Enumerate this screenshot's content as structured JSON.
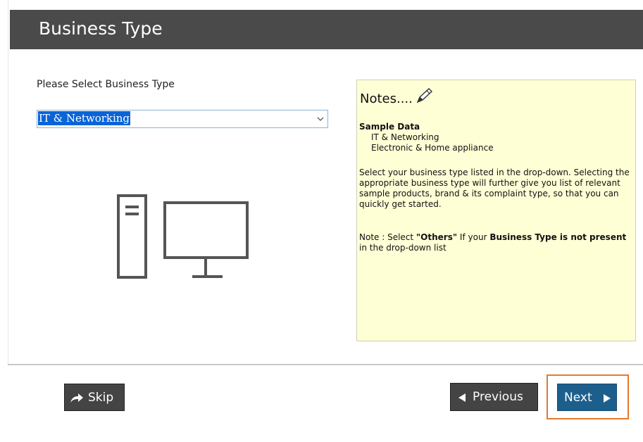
{
  "header": {
    "title": "Business Type"
  },
  "form": {
    "label": "Please Select Business Type",
    "selected_value": "IT & Networking"
  },
  "notes": {
    "title": "Notes....",
    "sample_heading": "Sample Data",
    "sample_items": [
      "IT & Networking",
      "Electronic & Home appliance"
    ],
    "paragraph_1": "Select your business type listed in the drop-down. Selecting the appropriate business type will further give you list of relevant sample products, brand & its complaint type, so that you can quickly get started.",
    "paragraph_2_parts": [
      "Note : Select ",
      "\"Others\"",
      " If your ",
      "Business Type is not present",
      " in the drop-down list"
    ]
  },
  "footer": {
    "skip_label": "Skip",
    "previous_label": "Previous",
    "next_label": "Next"
  },
  "icons": {
    "dropdown": "chevron-down-icon",
    "illustration": "computer-icon",
    "pencil": "pencil-icon",
    "skip": "share-arrow-icon",
    "previous": "triangle-left-icon",
    "next": "triangle-right-icon"
  },
  "colors": {
    "header_bg": "#4a4a4a",
    "notes_bg": "#ffffd6",
    "selected_bg": "#0a64d8",
    "next_button_bg": "#1d5f8c",
    "secondary_button_bg": "#444444",
    "focus_ring": "#e57a2c"
  }
}
